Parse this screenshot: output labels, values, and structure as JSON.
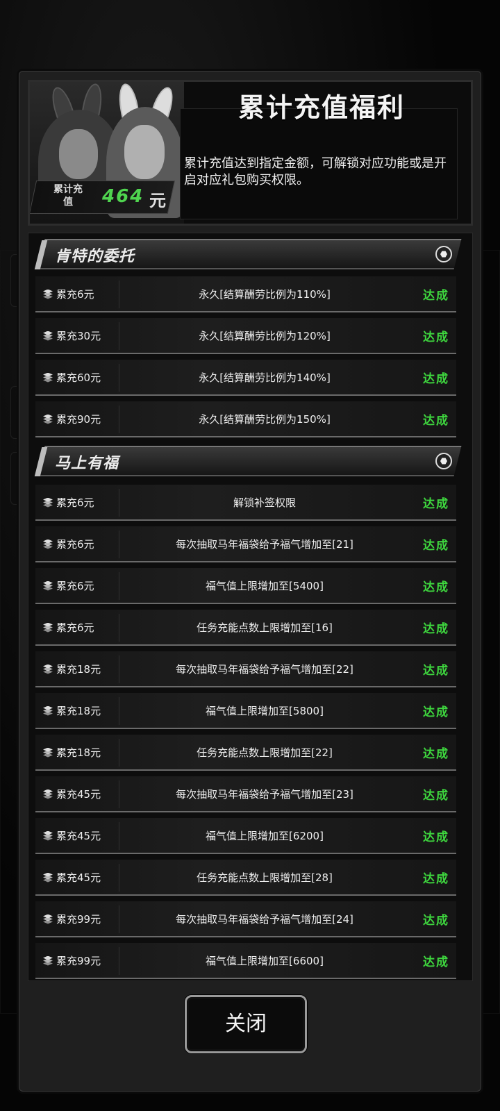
{
  "header": {
    "title": "累计充值福利",
    "description": "累计充值达到指定金额，可解锁对应功能或是开启对应礼包购买权限。",
    "total_label": "累计充值",
    "total_value": "464",
    "total_unit": "元"
  },
  "sections": [
    {
      "label": "肯特的委托",
      "rows": [
        {
          "req": "累充6元",
          "reward": "永久[结算酬劳比例为110%]",
          "status": "达成"
        },
        {
          "req": "累充30元",
          "reward": "永久[结算酬劳比例为120%]",
          "status": "达成"
        },
        {
          "req": "累充60元",
          "reward": "永久[结算酬劳比例为140%]",
          "status": "达成"
        },
        {
          "req": "累充90元",
          "reward": "永久[结算酬劳比例为150%]",
          "status": "达成"
        }
      ]
    },
    {
      "label": "马上有福",
      "rows": [
        {
          "req": "累充6元",
          "reward": "解锁补签权限",
          "status": "达成"
        },
        {
          "req": "累充6元",
          "reward": "每次抽取马年福袋给予福气增加至[21]",
          "status": "达成"
        },
        {
          "req": "累充6元",
          "reward": "福气值上限增加至[5400]",
          "status": "达成"
        },
        {
          "req": "累充6元",
          "reward": "任务充能点数上限增加至[16]",
          "status": "达成"
        },
        {
          "req": "累充18元",
          "reward": "每次抽取马年福袋给予福气增加至[22]",
          "status": "达成"
        },
        {
          "req": "累充18元",
          "reward": "福气值上限增加至[5800]",
          "status": "达成"
        },
        {
          "req": "累充18元",
          "reward": "任务充能点数上限增加至[22]",
          "status": "达成"
        },
        {
          "req": "累充45元",
          "reward": "每次抽取马年福袋给予福气增加至[23]",
          "status": "达成"
        },
        {
          "req": "累充45元",
          "reward": "福气值上限增加至[6200]",
          "status": "达成"
        },
        {
          "req": "累充45元",
          "reward": "任务充能点数上限增加至[28]",
          "status": "达成"
        },
        {
          "req": "累充99元",
          "reward": "每次抽取马年福袋给予福气增加至[24]",
          "status": "达成"
        },
        {
          "req": "累充99元",
          "reward": "福气值上限增加至[6600]",
          "status": "达成"
        }
      ]
    }
  ],
  "close_label": "关闭",
  "colors": {
    "achieved": "#3ed63e",
    "total_value": "#4fd44f"
  },
  "icons": {
    "row": "stack-icon",
    "section": "hexagon-icon"
  }
}
